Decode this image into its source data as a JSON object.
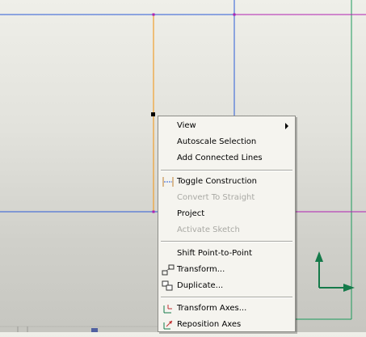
{
  "context_menu": {
    "items": [
      {
        "label": "View",
        "enabled": true,
        "submenu": true,
        "icon": null
      },
      {
        "label": "Autoscale Selection",
        "enabled": true,
        "icon": null
      },
      {
        "label": "Add Connected Lines",
        "enabled": true,
        "icon": null
      },
      {
        "label": "Toggle Construction",
        "enabled": true,
        "icon": "construction-line-icon"
      },
      {
        "label": "Convert To Straight",
        "enabled": false,
        "icon": null
      },
      {
        "label": "Project",
        "enabled": true,
        "icon": null
      },
      {
        "label": "Activate Sketch",
        "enabled": false,
        "icon": null
      },
      {
        "label": "Shift Point-to-Point",
        "enabled": true,
        "icon": null
      },
      {
        "label": "Transform...",
        "enabled": true,
        "icon": "transform-icon"
      },
      {
        "label": "Duplicate...",
        "enabled": true,
        "icon": "duplicate-icon"
      },
      {
        "label": "Transform Axes...",
        "enabled": true,
        "icon": "transform-axes-icon"
      },
      {
        "label": "Reposition Axes",
        "enabled": true,
        "icon": "reposition-axes-icon"
      }
    ]
  },
  "colors": {
    "blue_line": "#2a5bd7",
    "orange_line": "#f0a030",
    "magenta_line": "#b020b0",
    "green_frame": "#1a9a5a",
    "axis_green": "#157a4a"
  }
}
